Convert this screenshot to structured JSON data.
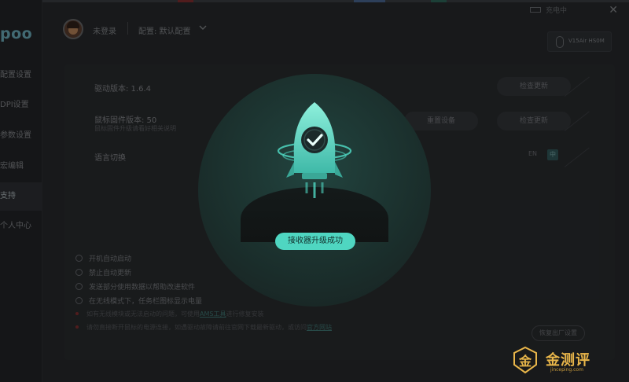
{
  "brand": {
    "logo_text": "poo"
  },
  "sidebar": {
    "items": [
      {
        "label": "配置设置"
      },
      {
        "label": "DPI设置"
      },
      {
        "label": "参数设置"
      },
      {
        "label": "宏编辑"
      },
      {
        "label": "支持",
        "active": true
      },
      {
        "label": "个人中心"
      }
    ]
  },
  "header": {
    "login_status": "未登录",
    "profile_label": "配置: 默认配置",
    "charge_status": "充电中",
    "close_glyph": "✕",
    "device_label": "V15Air HS0M"
  },
  "panel": {
    "driver_version_label": "驱动版本: 1.6.4",
    "firmware_version_label": "鼠标固件版本: 50",
    "firmware_note": "鼠标固件升级请看好相关说明",
    "language_label": "语言切换",
    "check_update_label": "检查更新",
    "reset_device_label": "重置设备",
    "check_update2_label": "检查更新",
    "lang_en": "EN",
    "lang_zh": "中",
    "options": [
      {
        "label": "开机自动启动"
      },
      {
        "label": "禁止自动更新"
      },
      {
        "label": "发送部分使用数据以帮助改进软件"
      },
      {
        "label": "在无线模式下，任务栏图标显示电量"
      }
    ],
    "note1_prefix": "如有无线模块或无法启动的问题，可使用",
    "note1_link": "AMS工具",
    "note1_suffix": "进行修复安装",
    "note2_prefix": "请勿直接断开鼠标的电源连接，如遇驱动故障请前往官网下载最新驱动，或访问",
    "note2_link": "官方网站",
    "restore_label": "恢复出厂设置"
  },
  "overlay": {
    "toast": "接收器升级成功",
    "accent": "#4fd6c1"
  },
  "watermark": {
    "text": "金测评",
    "url": "jinceping.com",
    "badge_glyph": "金"
  }
}
